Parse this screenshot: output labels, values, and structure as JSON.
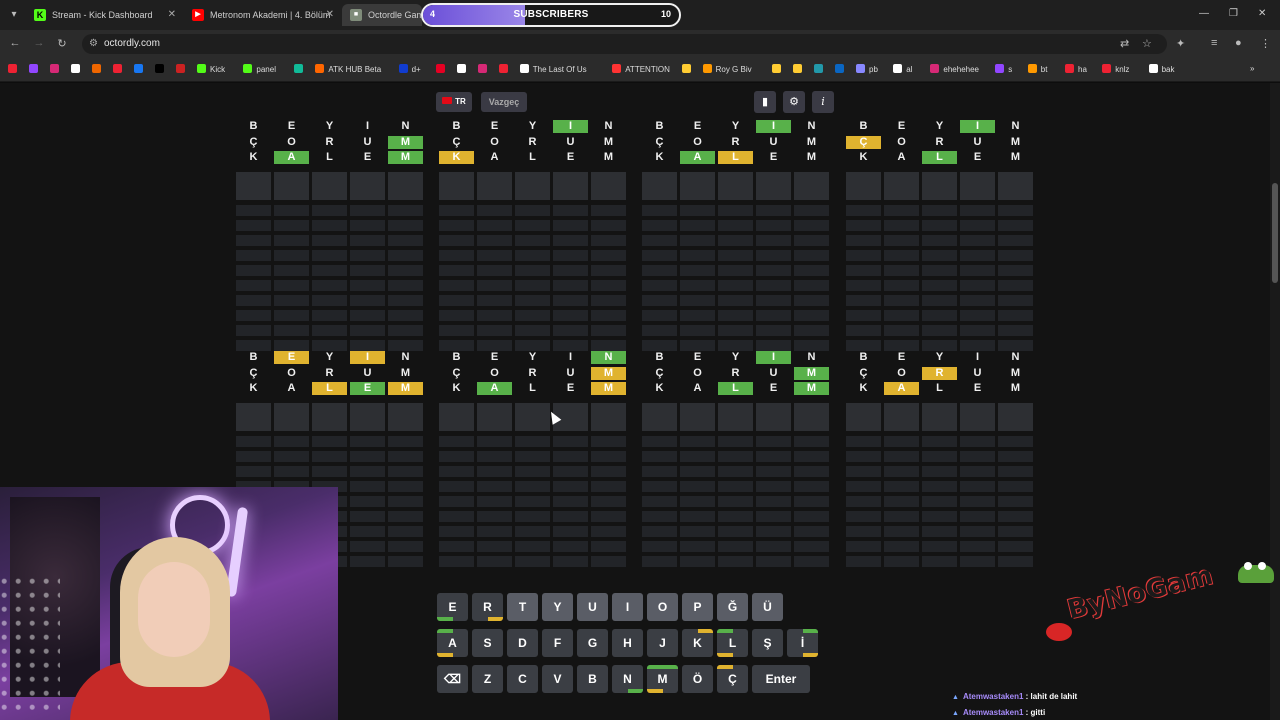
{
  "browser": {
    "tabs": [
      {
        "title": "Stream - Kick Dashboard",
        "icon": "kick-icon",
        "color": "#53fc18",
        "active": false
      },
      {
        "title": "Metronom Akademi | 4. Bölüm",
        "icon": "youtube-icon",
        "color": "#ff0000",
        "active": false
      },
      {
        "title": "Octordle Game",
        "icon": "octordle-icon",
        "color": "#9aa",
        "active": true
      }
    ],
    "url": "octordly.com",
    "bookmarks": [
      {
        "label": "",
        "color": "#e23"
      },
      {
        "label": "",
        "color": "#9146ff"
      },
      {
        "label": "",
        "color": "#d62976"
      },
      {
        "label": "",
        "color": "#fff"
      },
      {
        "label": "",
        "color": "#e60"
      },
      {
        "label": "",
        "color": "#e23"
      },
      {
        "label": "",
        "color": "#1877f2"
      },
      {
        "label": "",
        "color": "#000"
      },
      {
        "label": "",
        "color": "#c22"
      },
      {
        "label": "Kick",
        "color": "#53fc18"
      },
      {
        "label": "panel",
        "color": "#53fc18"
      },
      {
        "label": "",
        "color": "#1b9"
      },
      {
        "label": "ATK HUB Beta",
        "color": "#f60"
      },
      {
        "label": "d+",
        "color": "#113ccf"
      },
      {
        "label": "",
        "color": "#e60023"
      },
      {
        "label": "",
        "color": "#fff"
      },
      {
        "label": "",
        "color": "#d62976"
      },
      {
        "label": "",
        "color": "#e23"
      },
      {
        "label": "The Last Of Us",
        "color": "#fff"
      },
      {
        "label": "ATTENTION",
        "color": "#f33"
      },
      {
        "label": "",
        "color": "#fc3"
      },
      {
        "label": "Roy G Biv",
        "color": "#f90"
      },
      {
        "label": "",
        "color": "#fc3"
      },
      {
        "label": "",
        "color": "#fc3"
      },
      {
        "label": "",
        "color": "#29a"
      },
      {
        "label": "",
        "color": "#0a66c2"
      },
      {
        "label": "pb",
        "color": "#88f"
      },
      {
        "label": "al",
        "color": "#fff"
      },
      {
        "label": "ehehehee",
        "color": "#d62976"
      },
      {
        "label": "s",
        "color": "#9146ff"
      },
      {
        "label": "bt",
        "color": "#f90"
      },
      {
        "label": "ha",
        "color": "#e23"
      },
      {
        "label": "knlz",
        "color": "#e23"
      },
      {
        "label": "bak",
        "color": "#fff"
      }
    ]
  },
  "subscribers": {
    "current": "4",
    "label": "SUBSCRIBERS",
    "goal": "10",
    "progress": 0.4
  },
  "game": {
    "lang_label": "TR",
    "giveup_label": "Vazgeç",
    "icons": [
      "stats-icon",
      "settings-icon",
      "info-icon"
    ],
    "boards": [
      {
        "rows": [
          [
            "B",
            "E",
            "Y",
            "I",
            "N"
          ],
          [
            "Ç",
            "O",
            "R",
            "U",
            "M"
          ],
          [
            "K",
            "A",
            "L",
            "E",
            "M"
          ]
        ],
        "marks": [
          [
            "x",
            "x",
            "x",
            "x",
            "x"
          ],
          [
            "x",
            "x",
            "x",
            "x",
            "g"
          ],
          [
            "x",
            "g",
            "x",
            "x",
            "g"
          ]
        ]
      },
      {
        "rows": [
          [
            "B",
            "E",
            "Y",
            "I",
            "N"
          ],
          [
            "Ç",
            "O",
            "R",
            "U",
            "M"
          ],
          [
            "K",
            "A",
            "L",
            "E",
            "M"
          ]
        ],
        "marks": [
          [
            "x",
            "x",
            "x",
            "g",
            "x"
          ],
          [
            "x",
            "x",
            "x",
            "x",
            "x"
          ],
          [
            "y",
            "x",
            "x",
            "x",
            "x"
          ]
        ]
      },
      {
        "rows": [
          [
            "B",
            "E",
            "Y",
            "I",
            "N"
          ],
          [
            "Ç",
            "O",
            "R",
            "U",
            "M"
          ],
          [
            "K",
            "A",
            "L",
            "E",
            "M"
          ]
        ],
        "marks": [
          [
            "x",
            "x",
            "x",
            "g",
            "x"
          ],
          [
            "x",
            "x",
            "x",
            "x",
            "x"
          ],
          [
            "x",
            "g",
            "y",
            "x",
            "x"
          ]
        ]
      },
      {
        "rows": [
          [
            "B",
            "E",
            "Y",
            "I",
            "N"
          ],
          [
            "Ç",
            "O",
            "R",
            "U",
            "M"
          ],
          [
            "K",
            "A",
            "L",
            "E",
            "M"
          ]
        ],
        "marks": [
          [
            "x",
            "x",
            "x",
            "g",
            "x"
          ],
          [
            "y",
            "x",
            "x",
            "x",
            "x"
          ],
          [
            "x",
            "x",
            "g",
            "x",
            "x"
          ]
        ]
      },
      {
        "rows": [
          [
            "B",
            "E",
            "Y",
            "I",
            "N"
          ],
          [
            "Ç",
            "O",
            "R",
            "U",
            "M"
          ],
          [
            "K",
            "A",
            "L",
            "E",
            "M"
          ]
        ],
        "marks": [
          [
            "x",
            "y",
            "x",
            "y",
            "x"
          ],
          [
            "x",
            "x",
            "x",
            "x",
            "x"
          ],
          [
            "x",
            "x",
            "y",
            "g",
            "y"
          ]
        ]
      },
      {
        "rows": [
          [
            "B",
            "E",
            "Y",
            "I",
            "N"
          ],
          [
            "Ç",
            "O",
            "R",
            "U",
            "M"
          ],
          [
            "K",
            "A",
            "L",
            "E",
            "M"
          ]
        ],
        "marks": [
          [
            "x",
            "x",
            "x",
            "x",
            "g"
          ],
          [
            "x",
            "x",
            "x",
            "x",
            "y"
          ],
          [
            "x",
            "g",
            "x",
            "x",
            "y"
          ]
        ]
      },
      {
        "rows": [
          [
            "B",
            "E",
            "Y",
            "I",
            "N"
          ],
          [
            "Ç",
            "O",
            "R",
            "U",
            "M"
          ],
          [
            "K",
            "A",
            "L",
            "E",
            "M"
          ]
        ],
        "marks": [
          [
            "x",
            "x",
            "x",
            "g",
            "x"
          ],
          [
            "x",
            "x",
            "x",
            "x",
            "g"
          ],
          [
            "x",
            "x",
            "g",
            "x",
            "g"
          ]
        ]
      },
      {
        "rows": [
          [
            "B",
            "E",
            "Y",
            "I",
            "N"
          ],
          [
            "Ç",
            "O",
            "R",
            "U",
            "M"
          ],
          [
            "K",
            "A",
            "L",
            "E",
            "M"
          ]
        ],
        "marks": [
          [
            "x",
            "x",
            "x",
            "x",
            "x"
          ],
          [
            "x",
            "x",
            "y",
            "x",
            "x"
          ],
          [
            "x",
            "y",
            "x",
            "x",
            "x"
          ]
        ]
      }
    ],
    "keyboard": {
      "row1": [
        "E",
        "R",
        "T",
        "Y",
        "U",
        "I",
        "O",
        "P",
        "Ğ",
        "Ü"
      ],
      "row2": [
        "A",
        "S",
        "D",
        "F",
        "G",
        "H",
        "J",
        "K",
        "L",
        "Ş",
        "İ"
      ],
      "row3": [
        "⌫",
        "Z",
        "C",
        "V",
        "B",
        "N",
        "M",
        "Ö",
        "Ç",
        "Enter"
      ]
    }
  },
  "stream_overlay": {
    "logo_text": "ByNoGam",
    "chat": [
      {
        "user": "Atemwastaken1",
        "message": "lahit de lahit"
      },
      {
        "user": "Atemwastaken1",
        "message": "gitti"
      }
    ]
  },
  "colors": {
    "correct": "#58b14a",
    "present": "#e0b32f",
    "key": "#3b3e44",
    "accent": "#6b4fd8"
  }
}
